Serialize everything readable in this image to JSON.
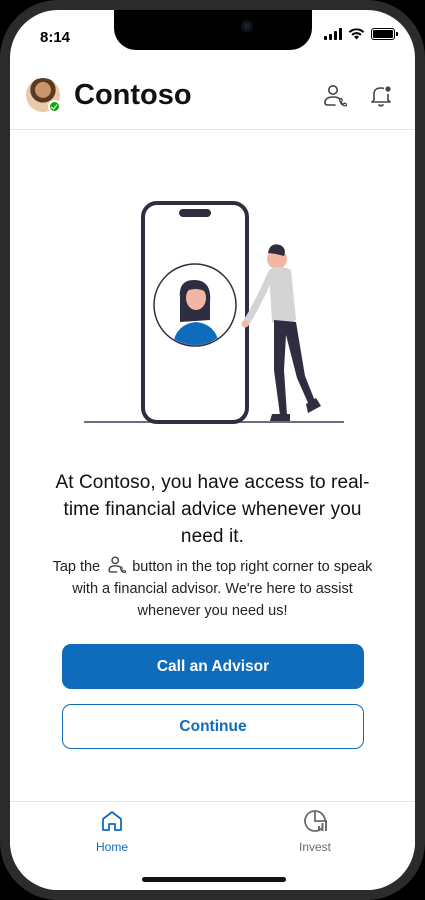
{
  "status_bar": {
    "time": "8:14"
  },
  "header": {
    "title": "Contoso",
    "avatar_presence": "available"
  },
  "hero": {
    "headline": "At Contoso, you have access to real-time financial advice whenever you need it.",
    "body_before_icon": "Tap the",
    "body_after_icon": "button in the top right corner to speak with a financial advisor. We're here to assist whenever you need us!"
  },
  "actions": {
    "primary_label": "Call an Advisor",
    "secondary_label": "Continue"
  },
  "tab_bar": {
    "items": [
      {
        "label": "Home",
        "icon": "home-icon",
        "active": true
      },
      {
        "label": "Invest",
        "icon": "chart-icon",
        "active": false
      }
    ]
  },
  "colors": {
    "brand": "#0f6cbd",
    "presence": "#13a10e",
    "text": "#111111"
  }
}
